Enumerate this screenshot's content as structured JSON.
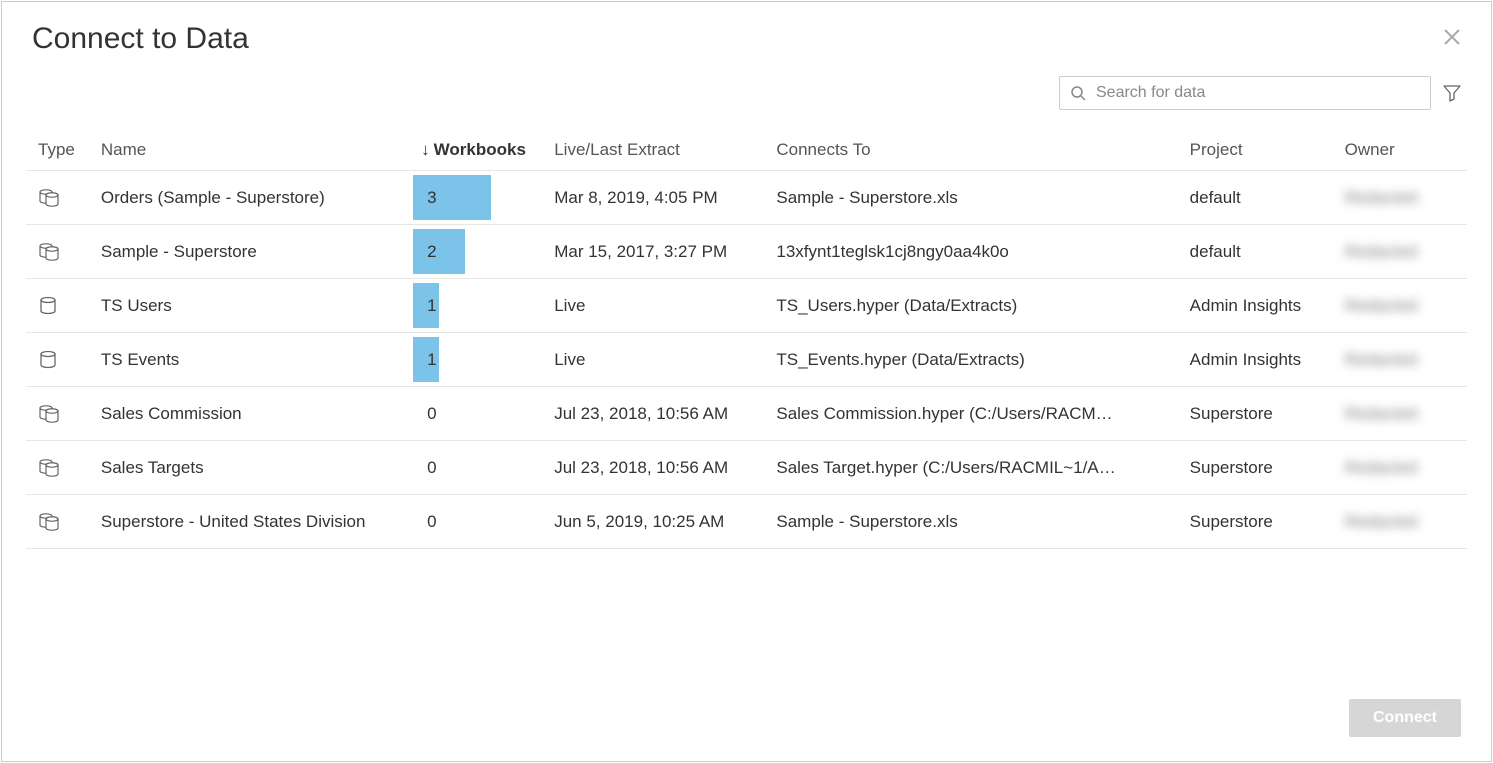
{
  "dialog": {
    "title": "Connect to Data"
  },
  "search": {
    "placeholder": "Search for data"
  },
  "columns": {
    "type": "Type",
    "name": "Name",
    "workbooks": "Workbooks",
    "live": "Live/Last Extract",
    "connects": "Connects To",
    "project": "Project",
    "owner": "Owner",
    "sort_indicator": "↓"
  },
  "chart_data": {
    "type": "bar",
    "title": "Workbooks",
    "categories": [
      "Orders (Sample - Superstore)",
      "Sample - Superstore",
      "TS Users",
      "TS Events",
      "Sales Commission",
      "Sales Targets",
      "Superstore - United States Division"
    ],
    "values": [
      3,
      2,
      1,
      1,
      0,
      0,
      0
    ],
    "xlabel": "",
    "ylabel": "Workbooks",
    "ylim": [
      0,
      3
    ]
  },
  "rows": [
    {
      "icon": "multi",
      "name": "Orders (Sample - Superstore)",
      "workbooks": 3,
      "live": "Mar 8, 2019, 4:05 PM",
      "connects": "Sample - Superstore.xls",
      "project": "default",
      "owner": "Redacted"
    },
    {
      "icon": "multi",
      "name": "Sample - Superstore",
      "workbooks": 2,
      "live": "Mar 15, 2017, 3:27 PM",
      "connects": "13xfynt1teglsk1cj8ngy0aa4k0o",
      "project": "default",
      "owner": "Redacted"
    },
    {
      "icon": "single",
      "name": "TS Users",
      "workbooks": 1,
      "live": "Live",
      "connects": "TS_Users.hyper (Data/Extracts)",
      "project": "Admin Insights",
      "owner": "Redacted"
    },
    {
      "icon": "single",
      "name": "TS Events",
      "workbooks": 1,
      "live": "Live",
      "connects": "TS_Events.hyper (Data/Extracts)",
      "project": "Admin Insights",
      "owner": "Redacted"
    },
    {
      "icon": "multi",
      "name": "Sales Commission",
      "workbooks": 0,
      "live": "Jul 23, 2018, 10:56 AM",
      "connects": "Sales Commission.hyper (C:/Users/RACM…",
      "project": "Superstore",
      "owner": "Redacted"
    },
    {
      "icon": "multi",
      "name": "Sales Targets",
      "workbooks": 0,
      "live": "Jul 23, 2018, 10:56 AM",
      "connects": "Sales Target.hyper (C:/Users/RACMIL~1/A…",
      "project": "Superstore",
      "owner": "Redacted"
    },
    {
      "icon": "multi",
      "name": "Superstore - United States Division",
      "workbooks": 0,
      "live": "Jun 5, 2019, 10:25 AM",
      "connects": "Sample - Superstore.xls",
      "project": "Superstore",
      "owner": "Redacted"
    }
  ],
  "footer": {
    "connect": "Connect"
  },
  "colors": {
    "bar": "#7bc3e8"
  }
}
